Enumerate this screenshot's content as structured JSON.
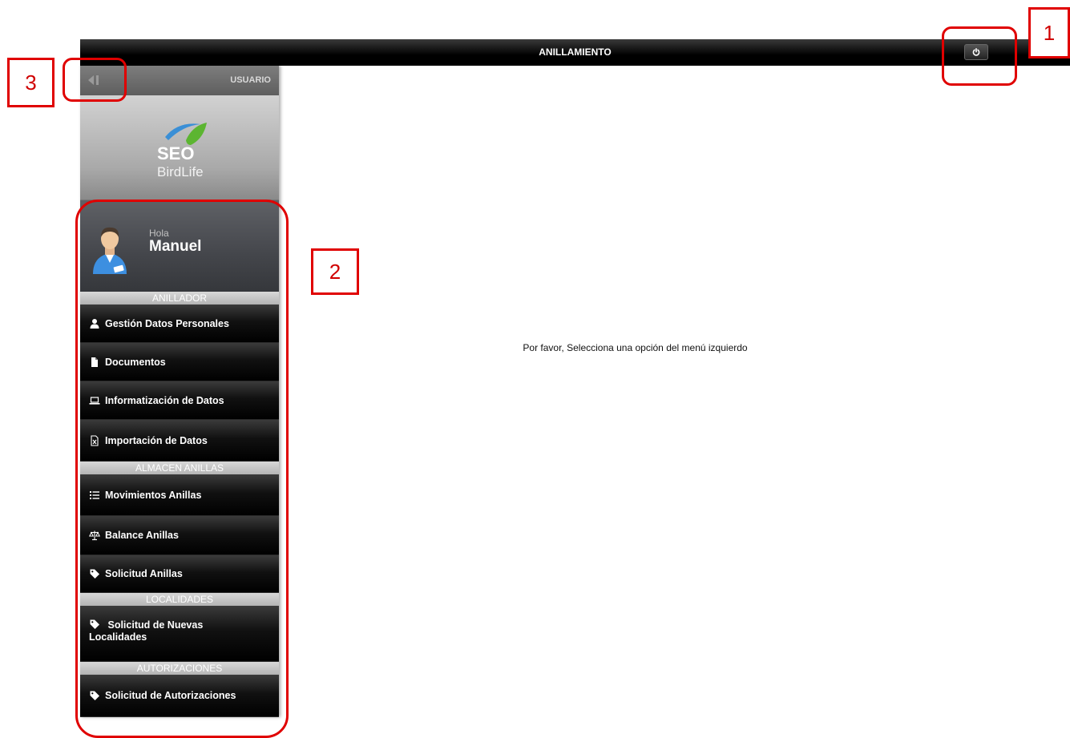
{
  "header": {
    "title": "ANILLAMIENTO",
    "power_icon": "power-icon"
  },
  "sidebar": {
    "user_label": "USUARIO",
    "logo": {
      "line1": "SEO",
      "line2": "BirdLife"
    },
    "greeting": "Hola",
    "username": "Manuel",
    "sections": [
      {
        "label": "ANILLADOR",
        "items": [
          {
            "label": "Gestión Datos Personales",
            "icon": "user-icon"
          },
          {
            "label": "Documentos",
            "icon": "document-icon"
          },
          {
            "label": "Informatización de Datos",
            "icon": "laptop-icon"
          },
          {
            "label": "Importación de Datos",
            "icon": "excel-file-icon"
          }
        ]
      },
      {
        "label": "ALMACEN ANILLAS",
        "items": [
          {
            "label": "Movimientos Anillas",
            "icon": "list-icon"
          },
          {
            "label": "Balance Anillas",
            "icon": "scale-icon"
          },
          {
            "label": "Solicitud Anillas",
            "icon": "tag-icon"
          }
        ]
      },
      {
        "label": "LOCALIDADES",
        "items": [
          {
            "label_line1": "Solicitud de Nuevas",
            "label_line2": "Localidades",
            "icon": "tag-icon"
          }
        ]
      },
      {
        "label": "AUTORIZACIONES",
        "items": [
          {
            "label": "Solicitud de Autorizaciones",
            "icon": "tag-icon"
          }
        ]
      }
    ]
  },
  "main": {
    "message": "Por favor, Selecciona una opción del menú izquierdo"
  },
  "callouts": [
    "1",
    "2",
    "3"
  ],
  "colors": {
    "callout": "#e00000",
    "topbar": "#000000",
    "logo_blue": "#3a8fd6",
    "logo_green": "#5cb531"
  }
}
